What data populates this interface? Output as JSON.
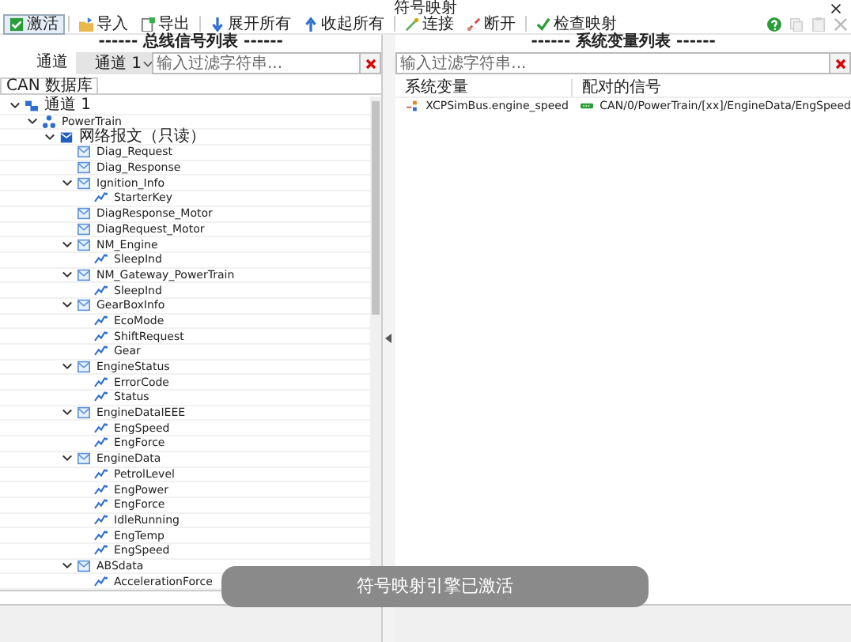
{
  "window": {
    "title": "符号映射"
  },
  "toolbar": [
    {
      "kind": "activate",
      "label": "激活"
    },
    {
      "kind": "import",
      "label": "导入"
    },
    {
      "kind": "export",
      "label": "导出"
    },
    {
      "kind": "expand",
      "label": "展开所有"
    },
    {
      "kind": "collapse",
      "label": "收起所有"
    },
    {
      "kind": "connect",
      "label": "连接"
    },
    {
      "kind": "disconnect",
      "label": "断开"
    },
    {
      "kind": "check",
      "label": "检查映射"
    }
  ],
  "toolbar_right": [
    {
      "kind": "help",
      "disabled": false
    },
    {
      "kind": "copy",
      "disabled": true
    },
    {
      "kind": "paste",
      "disabled": true
    },
    {
      "kind": "close",
      "disabled": true
    }
  ],
  "bus_panel": {
    "title": "------ 总线信号列表 ------",
    "channel_label": "通道",
    "channel_value": "通道 1",
    "filter_placeholder": "输入过滤字符串...",
    "tab": "CAN 数据库",
    "tree": [
      {
        "kind": "channel",
        "label": "通道 1",
        "expanded": true,
        "children": [
          {
            "kind": "cluster",
            "label": "PowerTrain",
            "expanded": true,
            "children": [
              {
                "kind": "folder",
                "label": "网络报文（只读）",
                "expanded": true,
                "children": [
                  {
                    "kind": "message",
                    "label": "Diag_Request"
                  },
                  {
                    "kind": "message",
                    "label": "Diag_Response"
                  },
                  {
                    "kind": "message",
                    "label": "Ignition_Info",
                    "expanded": true,
                    "children": [
                      {
                        "kind": "signal",
                        "label": "StarterKey"
                      }
                    ]
                  },
                  {
                    "kind": "message",
                    "label": "DiagResponse_Motor"
                  },
                  {
                    "kind": "message",
                    "label": "DiagRequest_Motor"
                  },
                  {
                    "kind": "message",
                    "label": "NM_Engine",
                    "expanded": true,
                    "children": [
                      {
                        "kind": "signal",
                        "label": "SleepInd"
                      }
                    ]
                  },
                  {
                    "kind": "message",
                    "label": "NM_Gateway_PowerTrain",
                    "expanded": true,
                    "children": [
                      {
                        "kind": "signal",
                        "label": "SleepInd"
                      }
                    ]
                  },
                  {
                    "kind": "message",
                    "label": "GearBoxInfo",
                    "expanded": true,
                    "children": [
                      {
                        "kind": "signal",
                        "label": "EcoMode"
                      },
                      {
                        "kind": "signal",
                        "label": "ShiftRequest"
                      },
                      {
                        "kind": "signal",
                        "label": "Gear"
                      }
                    ]
                  },
                  {
                    "kind": "message",
                    "label": "EngineStatus",
                    "expanded": true,
                    "children": [
                      {
                        "kind": "signal",
                        "label": "ErrorCode"
                      },
                      {
                        "kind": "signal",
                        "label": "Status"
                      }
                    ]
                  },
                  {
                    "kind": "message",
                    "label": "EngineDataIEEE",
                    "expanded": true,
                    "children": [
                      {
                        "kind": "signal",
                        "label": "EngSpeed"
                      },
                      {
                        "kind": "signal",
                        "label": "EngForce"
                      }
                    ]
                  },
                  {
                    "kind": "message",
                    "label": "EngineData",
                    "expanded": true,
                    "children": [
                      {
                        "kind": "signal",
                        "label": "PetrolLevel"
                      },
                      {
                        "kind": "signal",
                        "label": "EngPower"
                      },
                      {
                        "kind": "signal",
                        "label": "EngForce"
                      },
                      {
                        "kind": "signal",
                        "label": "IdleRunning"
                      },
                      {
                        "kind": "signal",
                        "label": "EngTemp"
                      },
                      {
                        "kind": "signal",
                        "label": "EngSpeed"
                      }
                    ]
                  },
                  {
                    "kind": "message",
                    "label": "ABSdata",
                    "expanded": true,
                    "children": [
                      {
                        "kind": "signal",
                        "label": "AccelerationForce"
                      }
                    ]
                  }
                ]
              }
            ]
          }
        ]
      }
    ]
  },
  "variable_panel": {
    "title": "------ 系统变量列表 ------",
    "filter_placeholder": "输入过滤字符串...",
    "columns": [
      "系统变量",
      "配对的信号"
    ],
    "rows": [
      {
        "variable": "XCPSimBus.engine_speed",
        "signal": "CAN/0/PowerTrain/[xx]/EngineData/EngSpeed"
      }
    ]
  },
  "toast": "符号映射引擎已激活"
}
